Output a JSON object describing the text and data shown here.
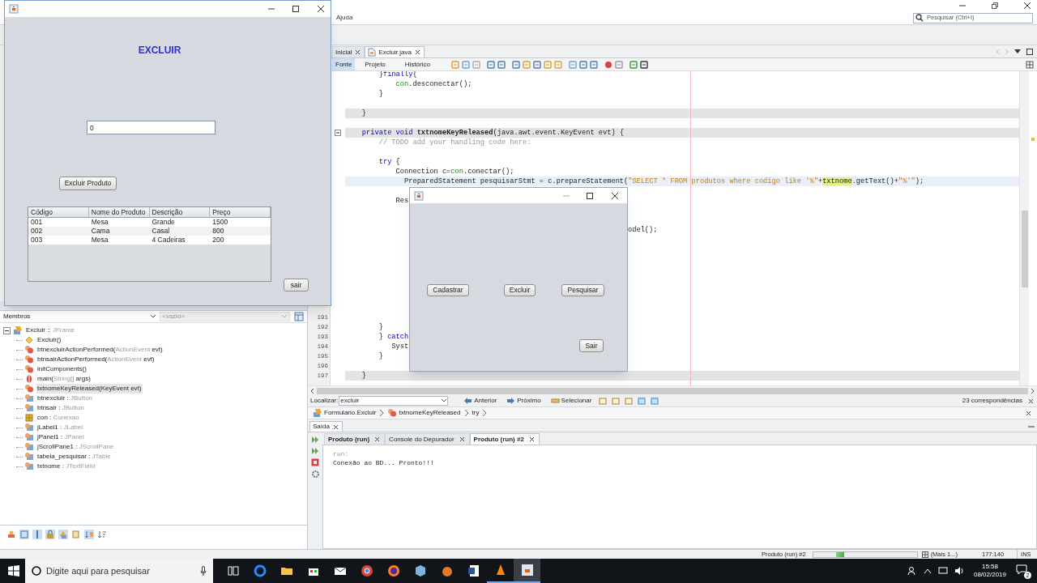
{
  "ide": {
    "menu": [
      "Ajuda"
    ],
    "search": {
      "placeholder": "Pesquisar (Ctrl+I)"
    },
    "editor_tabs": [
      {
        "label": "Inicial",
        "kind": "page",
        "selected": false
      },
      {
        "label": "Excluir.java",
        "kind": "file",
        "selected": true
      }
    ],
    "view_tabs": [
      {
        "label": "Fonte",
        "selected": true
      },
      {
        "label": "Projeto",
        "selected": false
      },
      {
        "label": "Histórico",
        "selected": false
      }
    ],
    "code_lines": [
      {
        "kind": "code",
        "tokens": [
          {
            "text": "        }",
            "kind": "plain"
          },
          {
            "text": "finally",
            "kind": "keyword"
          },
          {
            "text": "{",
            "kind": "plain"
          }
        ]
      },
      {
        "kind": "code",
        "tokens": [
          {
            "text": "            con",
            "kind": "field"
          },
          {
            "text": ".desconectar();",
            "kind": "plain"
          }
        ]
      },
      {
        "kind": "code",
        "tokens": [
          {
            "text": "        }",
            "kind": "plain"
          }
        ]
      },
      {
        "kind": "blank"
      },
      {
        "kind": "code",
        "brace_match": true,
        "tokens": [
          {
            "text": "    }",
            "kind": "plain"
          }
        ]
      },
      {
        "kind": "blank"
      },
      {
        "kind": "code",
        "brace_match": true,
        "fold": true,
        "tokens": [
          {
            "text": "    private void",
            "kind": "keyword"
          },
          {
            "text": " txtnomeKeyReleased",
            "kind": "method"
          },
          {
            "text": "(java.awt.event.KeyEvent evt) {",
            "kind": "plain"
          }
        ]
      },
      {
        "kind": "code",
        "tokens": [
          {
            "text": "        // TODO add your handling code here:",
            "kind": "comment"
          }
        ]
      },
      {
        "kind": "blank"
      },
      {
        "kind": "code",
        "tokens": [
          {
            "text": "        try",
            "kind": "keyword"
          },
          {
            "text": " {",
            "kind": "plain"
          }
        ]
      },
      {
        "kind": "code",
        "tokens": [
          {
            "text": "            Connection c=",
            "kind": "plain"
          },
          {
            "text": "con",
            "kind": "field"
          },
          {
            "text": ".conectar();",
            "kind": "plain"
          }
        ]
      },
      {
        "kind": "code",
        "current": true,
        "tokens": [
          {
            "text": "              PreparedStatement pesquisarStmt = c.prepareStatement(",
            "kind": "plain"
          },
          {
            "text": "\"SELECT * FROM produtos where codigo like '%\"",
            "kind": "string"
          },
          {
            "text": "+",
            "kind": "plain"
          },
          {
            "text": "txtnome",
            "kind": "mark"
          },
          {
            "text": ".getText()+",
            "kind": "plain"
          },
          {
            "text": "\"%'\"",
            "kind": "string"
          },
          {
            "text": ");",
            "kind": "plain"
          }
        ]
      },
      {
        "kind": "blank"
      },
      {
        "kind": "code",
        "tokens": [
          {
            "text": "            Res",
            "kind": "plain"
          }
        ]
      },
      {
        "kind": "blank"
      },
      {
        "kind": "blank"
      },
      {
        "kind": "fragment",
        "tokens": [
          {
            "text": "odel();",
            "kind": "plain"
          }
        ]
      },
      {
        "kind": "blank"
      },
      {
        "kind": "blank"
      },
      {
        "kind": "blank"
      },
      {
        "kind": "blank"
      },
      {
        "kind": "blank"
      },
      {
        "kind": "blank"
      },
      {
        "kind": "blank"
      },
      {
        "kind": "blank"
      },
      {
        "kind": "blank",
        "number": "191"
      },
      {
        "kind": "code",
        "number": "192",
        "tokens": [
          {
            "text": "        }",
            "kind": "plain"
          }
        ]
      },
      {
        "kind": "code",
        "number": "193",
        "tokens": [
          {
            "text": "        } ",
            "kind": "plain"
          },
          {
            "text": "catch",
            "kind": "keyword"
          }
        ]
      },
      {
        "kind": "code",
        "number": "194",
        "tokens": [
          {
            "text": "           Syst",
            "kind": "plain"
          }
        ]
      },
      {
        "kind": "code",
        "number": "195",
        "tokens": [
          {
            "text": "        }",
            "kind": "plain"
          }
        ]
      },
      {
        "kind": "blank",
        "number": "196"
      },
      {
        "kind": "code",
        "number": "197",
        "brace_match": true,
        "tokens": [
          {
            "text": "    }",
            "kind": "plain"
          }
        ]
      }
    ],
    "find_bar": {
      "label": "Localizar:",
      "value": "excluir",
      "buttons": [
        {
          "label": "Anterior",
          "kind": "previous"
        },
        {
          "label": "Próximo",
          "kind": "next"
        },
        {
          "label": "Selecionar",
          "kind": "select"
        }
      ],
      "matches": "23 correspondências"
    },
    "breadcrumbs": [
      {
        "label": "Formulario.Excluir",
        "kind": "class"
      },
      {
        "label": "txtnomeKeyReleased",
        "kind": "method"
      },
      {
        "label": "try",
        "kind": "block"
      }
    ],
    "navigator": {
      "filter": "Membros",
      "scope": "<vazio>",
      "tree": [
        {
          "kind": "class",
          "expanded": true,
          "selected": false,
          "tokens": [
            {
              "text": "Excluir :: ",
              "kind": "plain"
            },
            {
              "text": "JFrame",
              "kind": "dim"
            }
          ],
          "children": [
            {
              "kind": "constructor",
              "selected": false,
              "tokens": [
                {
                  "text": "Excluir()",
                  "kind": "plain"
                }
              ]
            },
            {
              "kind": "method",
              "selected": false,
              "tokens": [
                {
                  "text": "btnexcluirActionPerformed(",
                  "kind": "plain"
                },
                {
                  "text": "ActionEvent",
                  "kind": "dim"
                },
                {
                  "text": " evt)",
                  "kind": "plain"
                }
              ]
            },
            {
              "kind": "method",
              "selected": false,
              "tokens": [
                {
                  "text": "btnsairActionPerformed(",
                  "kind": "plain"
                },
                {
                  "text": "ActionEvent",
                  "kind": "dim"
                },
                {
                  "text": " evt)",
                  "kind": "plain"
                }
              ]
            },
            {
              "kind": "method",
              "selected": false,
              "tokens": [
                {
                  "text": "initComponents()",
                  "kind": "plain"
                }
              ]
            },
            {
              "kind": "static",
              "selected": false,
              "tokens": [
                {
                  "text": "main(",
                  "kind": "plain"
                },
                {
                  "text": "String[]",
                  "kind": "dim"
                },
                {
                  "text": " args)",
                  "kind": "plain"
                }
              ]
            },
            {
              "kind": "method",
              "selected": true,
              "tokens": [
                {
                  "text": "txtnomeKeyReleased(KeyEvent evt)",
                  "kind": "plain"
                }
              ]
            },
            {
              "kind": "field",
              "selected": false,
              "tokens": [
                {
                  "text": "btnexcluir : ",
                  "kind": "plain"
                },
                {
                  "text": "JButton",
                  "kind": "dim"
                }
              ]
            },
            {
              "kind": "field",
              "selected": false,
              "tokens": [
                {
                  "text": "btnsair : ",
                  "kind": "plain"
                },
                {
                  "text": "JButton",
                  "kind": "dim"
                }
              ]
            },
            {
              "kind": "object",
              "selected": false,
              "tokens": [
                {
                  "text": "con : ",
                  "kind": "plain"
                },
                {
                  "text": "Conexao",
                  "kind": "dim"
                }
              ]
            },
            {
              "kind": "field",
              "selected": false,
              "tokens": [
                {
                  "text": "jLabel1 : ",
                  "kind": "plain"
                },
                {
                  "text": "JLabel",
                  "kind": "dim"
                }
              ]
            },
            {
              "kind": "field",
              "selected": false,
              "tokens": [
                {
                  "text": "jPanel1 : ",
                  "kind": "plain"
                },
                {
                  "text": "JPanel",
                  "kind": "dim"
                }
              ]
            },
            {
              "kind": "field",
              "selected": false,
              "tokens": [
                {
                  "text": "jScrollPane1 : ",
                  "kind": "plain"
                },
                {
                  "text": "JScrollPane",
                  "kind": "dim"
                }
              ]
            },
            {
              "kind": "field",
              "selected": false,
              "tokens": [
                {
                  "text": "tabela_pesquisar : ",
                  "kind": "plain"
                },
                {
                  "text": "JTable",
                  "kind": "dim"
                }
              ]
            },
            {
              "kind": "field",
              "selected": false,
              "tokens": [
                {
                  "text": "txtnome : ",
                  "kind": "plain"
                },
                {
                  "text": "JTextField",
                  "kind": "dim"
                }
              ]
            }
          ]
        }
      ]
    },
    "output": {
      "title": "Saída",
      "tabs": [
        {
          "label": "Produto (run)",
          "running": true,
          "selected": false
        },
        {
          "label": "Console do Depurador",
          "running": false,
          "selected": false
        },
        {
          "label": "Produto (run) #2",
          "running": true,
          "selected": true
        }
      ],
      "lines": [
        {
          "text": "run:",
          "kind": "meta"
        },
        {
          "text": "Conexão ao BD... Pronto!!!",
          "kind": "plain"
        }
      ]
    },
    "status_bar": {
      "task": "Produto (run) #2",
      "more": "(Mais 1...)",
      "position": "177:140",
      "mode": "INS"
    }
  },
  "form_window": {
    "heading": "EXCLUIR",
    "field": {
      "value": "0"
    },
    "button": "Excluir Produto",
    "table": {
      "columns": [
        "Código",
        "Nome do Produto",
        "Descrição",
        "Preço"
      ],
      "rows": [
        [
          "001",
          "Mesa",
          "Grande",
          "1500"
        ],
        [
          "002",
          "Cama",
          "Casal",
          "800"
        ],
        [
          "003",
          "Mesa",
          "4 Cadeiras",
          "200"
        ]
      ]
    },
    "exit_button": "sair"
  },
  "menu_window": {
    "buttons": [
      "Cadastrar",
      "Excluir",
      "Pesquisar"
    ],
    "exit_button": "Sair"
  },
  "taskbar": {
    "search": {
      "placeholder": "Digite aqui para pesquisar"
    },
    "time": "15:58",
    "date": "08/02/2019",
    "notifications": "2"
  }
}
